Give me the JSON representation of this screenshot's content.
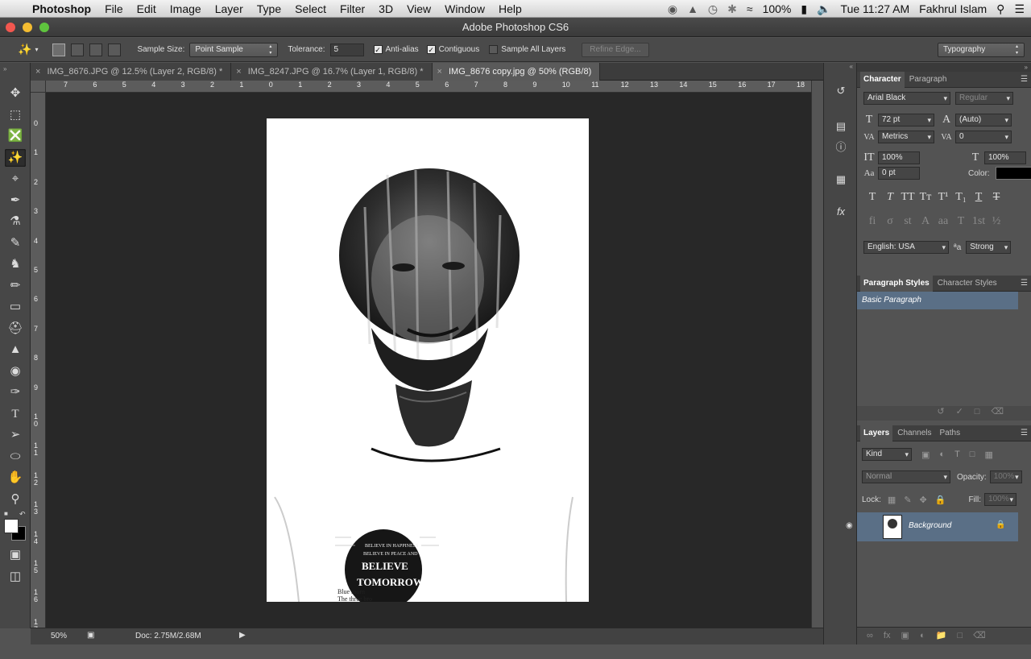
{
  "menubar": {
    "app_name": "Photoshop",
    "items": [
      "File",
      "Edit",
      "Image",
      "Layer",
      "Type",
      "Select",
      "Filter",
      "3D",
      "View",
      "Window",
      "Help"
    ],
    "battery": "100%",
    "clock": "Tue 11:27 AM",
    "user": "Fakhrul Islam"
  },
  "window": {
    "title": "Adobe Photoshop CS6"
  },
  "options": {
    "sample_size_label": "Sample Size:",
    "sample_size_value": "Point Sample",
    "tolerance_label": "Tolerance:",
    "tolerance_value": "5",
    "anti_alias_label": "Anti-alias",
    "contiguous_label": "Contiguous",
    "sample_all_label": "Sample All Layers",
    "refine_edge_label": "Refine Edge...",
    "workspace": "Typography"
  },
  "tabs": [
    {
      "label": "IMG_8676.JPG @ 12.5% (Layer 2, RGB/8) *"
    },
    {
      "label": "IMG_8247.JPG @ 16.7% (Layer 1, RGB/8) *"
    },
    {
      "label": "IMG_8676 copy.jpg @ 50% (RGB/8)"
    }
  ],
  "ruler": {
    "h": [
      "7",
      "6",
      "5",
      "4",
      "3",
      "2",
      "1",
      "0",
      "1",
      "2",
      "3",
      "4",
      "5",
      "6",
      "7",
      "8",
      "9",
      "10",
      "11",
      "12",
      "13",
      "14",
      "15",
      "16",
      "17",
      "18"
    ],
    "v": [
      "0",
      "1",
      "2",
      "3",
      "4",
      "5",
      "6",
      "7",
      "8",
      "9",
      "1\n0",
      "1\n1",
      "1\n2",
      "1\n3",
      "1\n4",
      "1\n5",
      "1\n6",
      "1\n7"
    ]
  },
  "status": {
    "zoom": "50%",
    "doc": "Doc: 2.75M/2.68M"
  },
  "character": {
    "tab_character": "Character",
    "tab_paragraph": "Paragraph",
    "font_family": "Arial Black",
    "font_style": "Regular",
    "font_size": "72 pt",
    "leading": "(Auto)",
    "kerning": "Metrics",
    "tracking": "0",
    "vscale": "100%",
    "hscale": "100%",
    "baseline": "0 pt",
    "color_label": "Color:",
    "color": "#000000",
    "language": "English: USA",
    "aa_symbol": "ªa",
    "antialias": "Strong"
  },
  "paragraph_styles": {
    "tab1": "Paragraph Styles",
    "tab2": "Character Styles",
    "item": "Basic Paragraph"
  },
  "layers": {
    "tab_layers": "Layers",
    "tab_channels": "Channels",
    "tab_paths": "Paths",
    "filter_kind": "Kind",
    "blend_mode": "Normal",
    "opacity_label": "Opacity:",
    "opacity": "100%",
    "lock_label": "Lock:",
    "fill_label": "Fill:",
    "fill": "100%",
    "layer_name": "Background"
  },
  "artwork": {
    "shirt_text_1": "BELIEVE IN HAPPINESS",
    "shirt_text_2": "BELIEVE IN PEACE AND",
    "shirt_text_3": "BELIEVE",
    "shirt_text_4": "TOMORROW",
    "shirt_text_5": "Blue morn",
    "shirt_text_6": "The three bro"
  }
}
